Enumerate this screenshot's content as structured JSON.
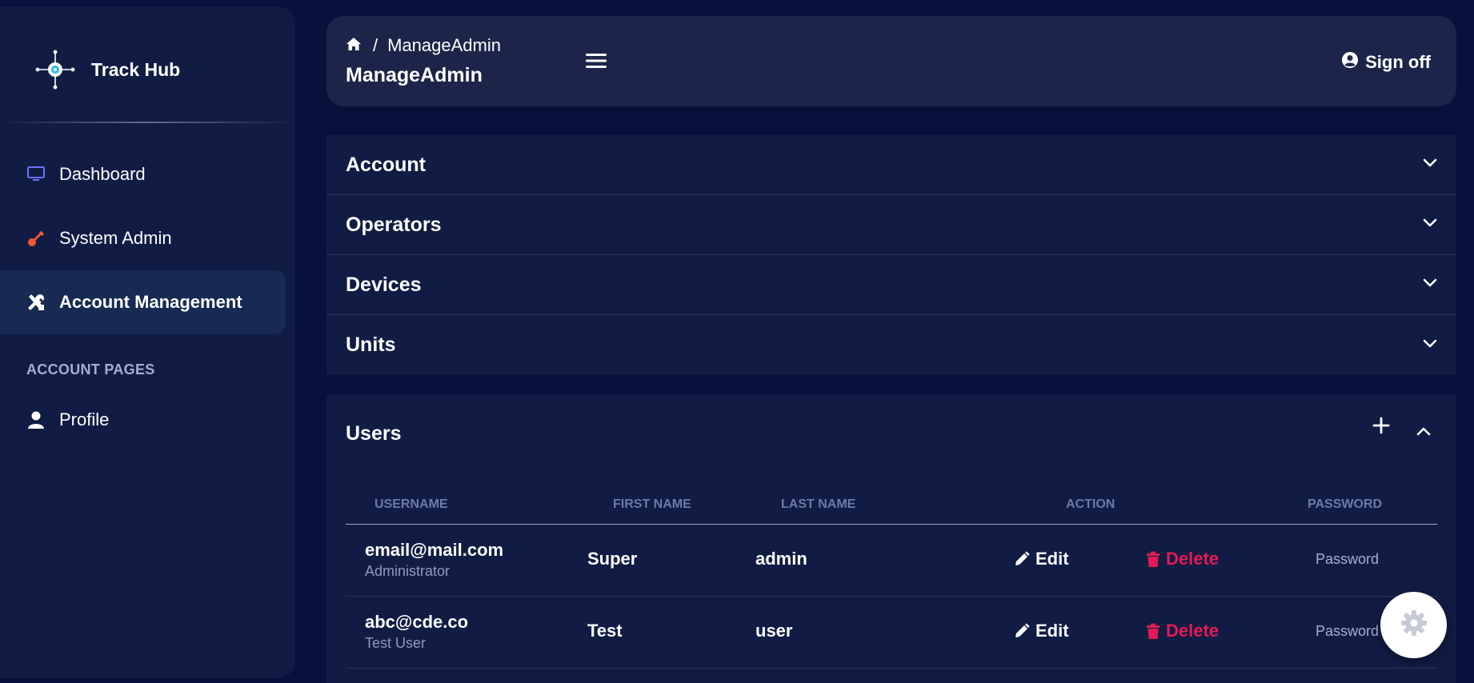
{
  "brand": {
    "name": "Track Hub"
  },
  "sidebar": {
    "items": [
      {
        "label": "Dashboard",
        "icon": "monitor-icon"
      },
      {
        "label": "System Admin",
        "icon": "key-icon"
      },
      {
        "label": "Account Management",
        "icon": "tools-icon",
        "active": true
      }
    ],
    "section_heading": "ACCOUNT PAGES",
    "pages": [
      {
        "label": "Profile",
        "icon": "person-icon"
      }
    ]
  },
  "header": {
    "breadcrumb": {
      "separator": "/",
      "current": "ManageAdmin"
    },
    "title": "ManageAdmin",
    "signoff_label": "Sign off"
  },
  "accordions": [
    {
      "title": "Account"
    },
    {
      "title": "Operators"
    },
    {
      "title": "Devices"
    },
    {
      "title": "Units"
    }
  ],
  "users": {
    "title": "Users",
    "columns": [
      "USERNAME",
      "FIRST NAME",
      "LAST NAME",
      "ACTION",
      "PASSWORD"
    ],
    "rows": [
      {
        "email": "email@mail.com",
        "role": "Administrator",
        "first_name": "Super",
        "last_name": "admin",
        "edit": "Edit",
        "delete": "Delete",
        "password": "Password"
      },
      {
        "email": "abc@cde.co",
        "role": "Test User",
        "first_name": "Test",
        "last_name": "user",
        "edit": "Edit",
        "delete": "Delete",
        "password": "Password"
      }
    ]
  },
  "colors": {
    "background": "#06113c",
    "panel": "#111c44",
    "topbar": "#1c2549",
    "active_nav": "#162a52",
    "delete": "#e31a56",
    "muted_text": "#a3aed0",
    "dashboard_icon": "#6c72f5",
    "system_admin_icon": "#f05a3a",
    "logo_center": "#29b6e8"
  }
}
